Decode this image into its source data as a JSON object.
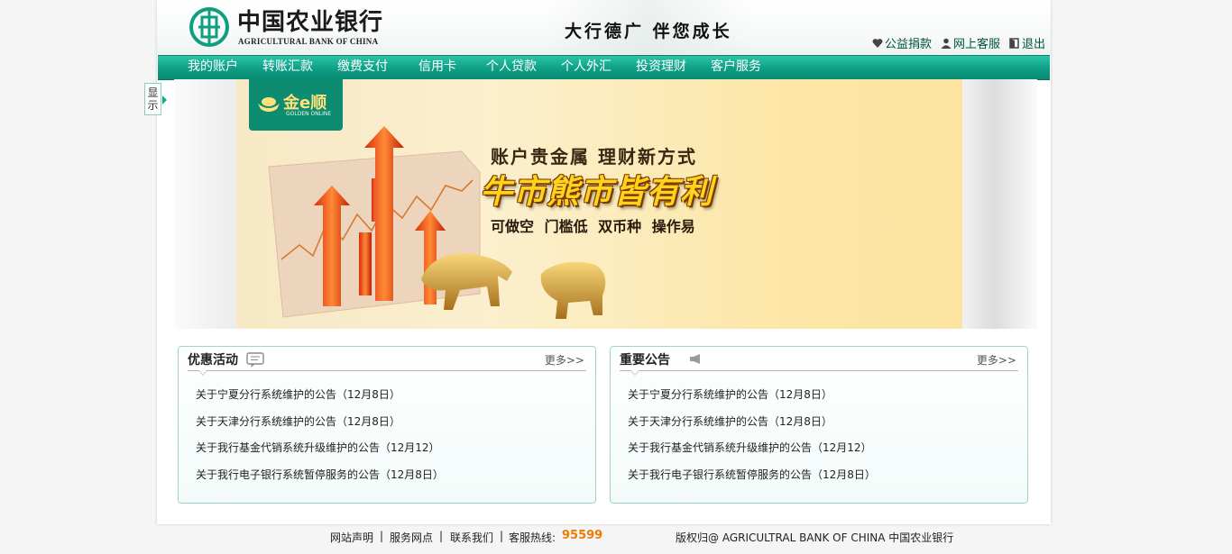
{
  "header": {
    "bank_name_cn": "中国农业银行",
    "bank_name_en": "AGRICULTURAL BANK OF CHINA",
    "slogan": "大行德广  伴您成长",
    "links": [
      {
        "label": "公益捐款",
        "icon": "heart-icon"
      },
      {
        "label": "网上客服",
        "icon": "person-icon"
      },
      {
        "label": "退出",
        "icon": "exit-icon"
      }
    ]
  },
  "nav": {
    "items": [
      "我的账户",
      "转账汇款",
      "缴费支付",
      "信用卡",
      "个人贷款",
      "个人外汇",
      "投资理财",
      "客户服务"
    ]
  },
  "side_tab": {
    "label": "显示"
  },
  "banner": {
    "brand": "金e顺",
    "brand_en": "GOLDEN ONLINE",
    "line1": "账户贵金属  理财新方式",
    "line2": "牛市熊市皆有利",
    "line3": "可做空   门槛低   双币种   操作易"
  },
  "promotions": {
    "title": "优惠活动",
    "more": "更多>>",
    "items": [
      "关于宁夏分行系统维护的公告（12月8日）",
      "关于天津分行系统维护的公告（12月8日）",
      "关于我行基金代销系统升级维护的公告（12月12）",
      "关于我行电子银行系统暂停服务的公告（12月8日）"
    ]
  },
  "notices": {
    "title": "重要公告",
    "more": "更多>>",
    "items": [
      "关于宁夏分行系统维护的公告（12月8日）",
      "关于天津分行系统维护的公告（12月8日）",
      "关于我行基金代销系统升级维护的公告（12月12）",
      "关于我行电子银行系统暂停服务的公告（12月8日）"
    ]
  },
  "footer": {
    "links": [
      "网站声明",
      "服务网点",
      "联系我们"
    ],
    "hotline_label": "客服热线:",
    "hotline": "95599",
    "copyright": "版权归@ AGRICULTRAL BANK OF CHINA 中国农业银行"
  },
  "colors": {
    "brand_green": "#0e9f86",
    "hotline_orange": "#f07b00"
  }
}
